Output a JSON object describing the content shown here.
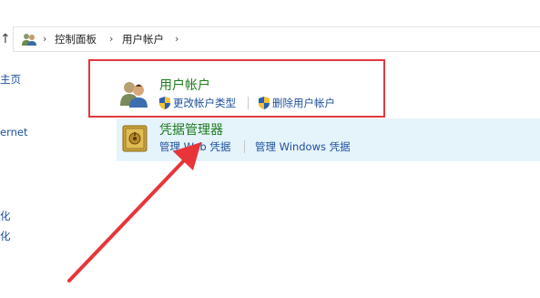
{
  "breadcrumb": {
    "items": [
      "控制面板",
      "用户帐户"
    ]
  },
  "sidebar": {
    "items": [
      "主页",
      "ernet",
      "化",
      "化"
    ]
  },
  "sections": [
    {
      "title": "用户帐户",
      "links": [
        "更改帐户类型",
        "删除用户帐户"
      ]
    },
    {
      "title": "凭据管理器",
      "links": [
        "管理 Web 凭据",
        "管理 Windows 凭据"
      ]
    }
  ],
  "colors": {
    "highlight_box": "#e0393e",
    "annotation_arrow": "#e8353a",
    "title_green": "#1e7a1e",
    "link_blue": "#1e4f9c",
    "selected_row": "#e5f3fb"
  }
}
